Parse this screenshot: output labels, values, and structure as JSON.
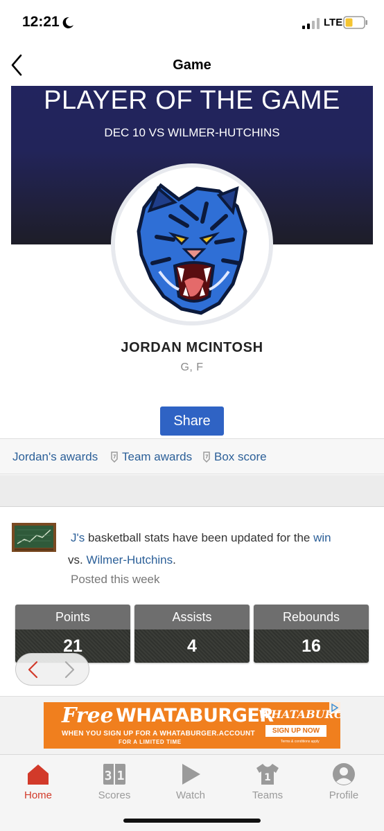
{
  "status": {
    "time": "12:21",
    "network": "LTE",
    "battery_color": "#f4c430"
  },
  "nav": {
    "title": "Game"
  },
  "banner": {
    "title": "PLAYER OF THE GAME",
    "subtitle": "DEC 10 VS WILMER-HUTCHINS",
    "avatar": "wildcat-mascot-logo"
  },
  "player": {
    "name": "JORDAN MCINTOSH",
    "position": "G, F"
  },
  "share_label": "Share",
  "links": [
    "Jordan's awards",
    "Team awards",
    "Box score"
  ],
  "feed": {
    "icon": "chalkboard-chart-icon",
    "text_start": "J's",
    "text_middle": " basketball stats have been updated for the ",
    "text_win": "win",
    "text_vs": " vs. ",
    "text_opponent": "Wilmer-Hutchins",
    "text_end": ".",
    "posted": "Posted this week"
  },
  "stats": [
    {
      "label": "Points",
      "value": "21"
    },
    {
      "label": "Assists",
      "value": "4"
    },
    {
      "label": "Rebounds",
      "value": "16"
    }
  ],
  "ad": {
    "free": "Free",
    "brand": "WHATABURGER",
    "line1": "WHEN YOU SIGN UP FOR A WHATABURGER.ACCOUNT",
    "line2": "FOR A LIMITED TIME",
    "logo": "WHATABURGER",
    "button": "SIGN UP NOW",
    "fine": "Terms & conditions apply",
    "color": "#f07f1e"
  },
  "tabs": [
    {
      "label": "Home",
      "icon": "home-icon",
      "active": true
    },
    {
      "label": "Scores",
      "icon": "scoreboard-icon",
      "active": false
    },
    {
      "label": "Watch",
      "icon": "play-icon",
      "active": false
    },
    {
      "label": "Teams",
      "icon": "jersey-icon",
      "active": false
    },
    {
      "label": "Profile",
      "icon": "profile-icon",
      "active": false
    }
  ],
  "colors": {
    "accent": "#2f63c4",
    "link": "#2b5f98",
    "active_tab": "#d23a2a",
    "banner": "#22245e"
  }
}
